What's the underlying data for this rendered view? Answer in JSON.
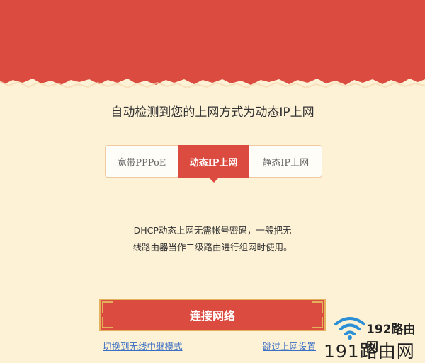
{
  "banner": {
    "color": "#db4b3f"
  },
  "headline": "自动检测到您的上网方式为动态IP上网",
  "tabs": [
    {
      "label": "宽带PPPoE",
      "active": false
    },
    {
      "label": "动态IP上网",
      "active": true
    },
    {
      "label": "静态IP上网",
      "active": false
    }
  ],
  "description": {
    "line1": "DHCP动态上网无需帐号密码，一般把无",
    "line2": "线路由器当作二级路由进行组网时使用。"
  },
  "connect_button": "连接网络",
  "links": {
    "switch_repeater": "切换到无线中继模式",
    "skip_setup": "跳过上网设置"
  },
  "watermark": {
    "top": "192路由网",
    "bottom": "191路由网"
  },
  "colors": {
    "accent": "#db4b3f",
    "background": "#fdf1d6",
    "gold": "#e3b25c",
    "link": "#3a6fc4"
  }
}
